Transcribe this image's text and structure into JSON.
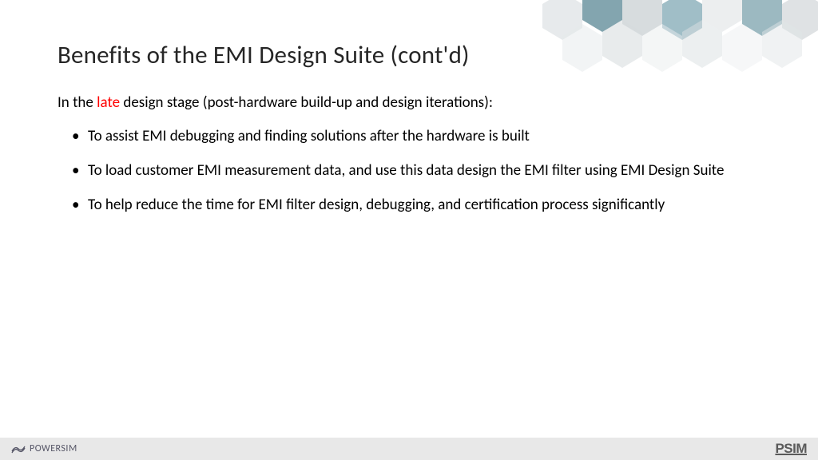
{
  "title": "Benefits of the EMI Design Suite (cont'd)",
  "intro": {
    "pre": "In the ",
    "highlight": "late",
    "post": " design stage (post-hardware build-up and design iterations):"
  },
  "bullets": [
    "To assist EMI debugging and finding solutions after the hardware is built",
    "To load customer EMI measurement data, and use this data design the EMI filter using EMI Design Suite",
    "To help reduce the time for EMI filter design, debugging, and certification process significantly"
  ],
  "footer": {
    "leftLogo": "POWERSIM",
    "rightLogo": "PSIM"
  }
}
